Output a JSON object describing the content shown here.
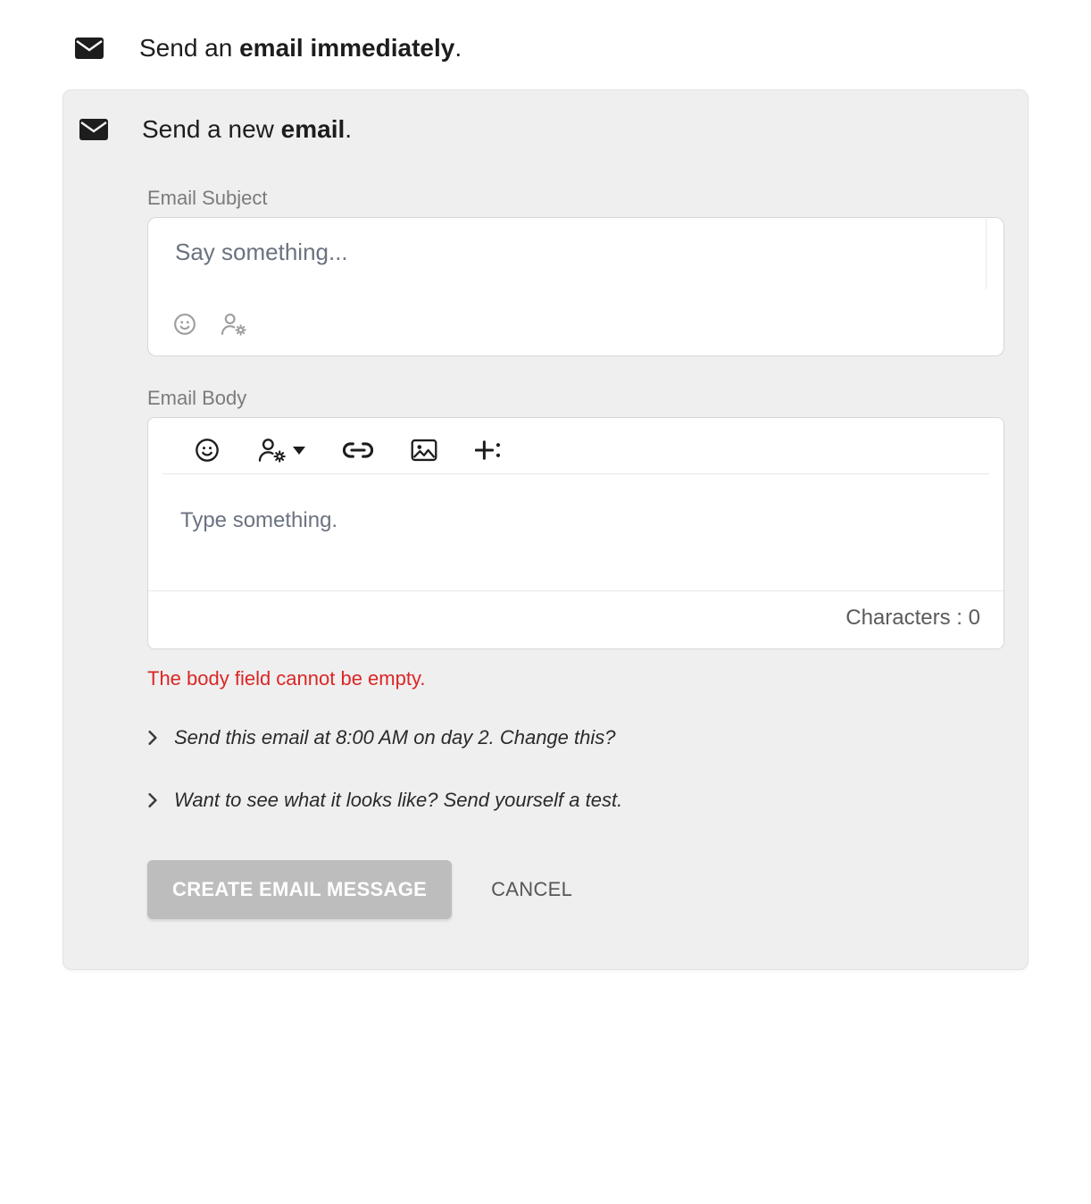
{
  "topOption": {
    "prefix": "Send an ",
    "bold": "email immediately",
    "suffix": "."
  },
  "card": {
    "header": {
      "prefix": "Send a new ",
      "bold": "email",
      "suffix": "."
    },
    "subject": {
      "label": "Email Subject",
      "placeholder": "Say something...",
      "value": ""
    },
    "body": {
      "label": "Email Body",
      "placeholder": "Type something.",
      "char_label": "Characters : ",
      "char_count": "0",
      "value": ""
    },
    "error": "The body field cannot be empty.",
    "expanders": {
      "schedule": "Send this email at 8:00 AM on day 2. Change this?",
      "preview": "Want to see what it looks like? Send yourself a test."
    },
    "buttons": {
      "create": "Create Email Message",
      "cancel": "Cancel"
    }
  }
}
